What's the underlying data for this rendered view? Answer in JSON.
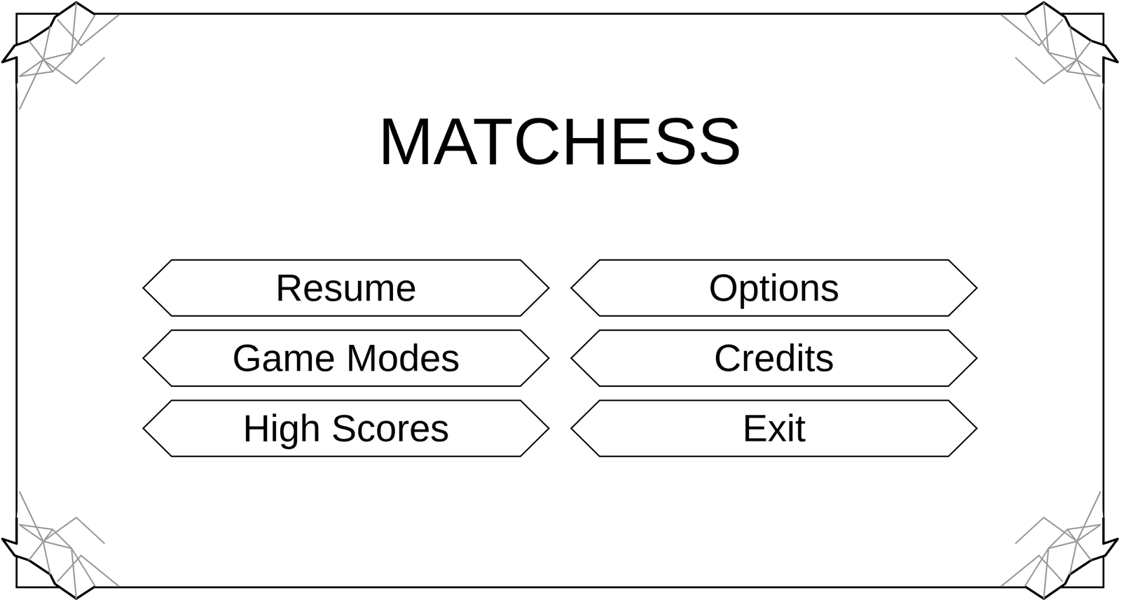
{
  "title": "MATCHESS",
  "menu": [
    {
      "label": "Resume"
    },
    {
      "label": "Options"
    },
    {
      "label": "Game Modes"
    },
    {
      "label": "Credits"
    },
    {
      "label": "High Scores"
    },
    {
      "label": "Exit"
    }
  ]
}
